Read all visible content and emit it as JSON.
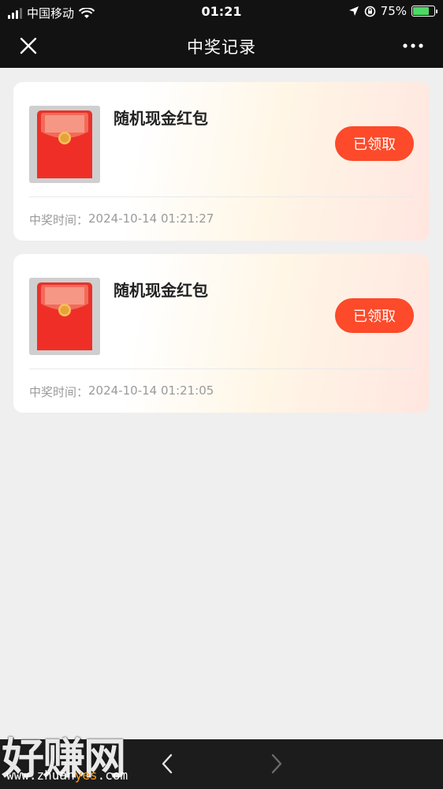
{
  "status_bar": {
    "carrier": "中国移动",
    "time": "01:21",
    "battery": "75%"
  },
  "nav": {
    "title": "中奖记录",
    "close_icon": "close-icon",
    "more_icon": "more-dots-icon"
  },
  "records": [
    {
      "name": "随机现金红包",
      "button_label": "已领取",
      "time_label": "中奖时间：",
      "time_value": "2024-10-14 01:21:27"
    },
    {
      "name": "随机现金红包",
      "button_label": "已领取",
      "time_label": "中奖时间：",
      "time_value": "2024-10-14 01:21:05"
    }
  ],
  "bottom_bar": {
    "back_icon": "chevron-left-icon",
    "forward_icon": "chevron-right-icon"
  },
  "watermark": {
    "text": "好赚网",
    "url_prefix": "www.zhuan",
    "url_highlight": "yes",
    "url_suffix": ".com"
  },
  "colors": {
    "accent": "#fc4a2a",
    "header_bg": "#121212",
    "page_bg": "#efefef",
    "battery_fill": "#4cd964"
  }
}
